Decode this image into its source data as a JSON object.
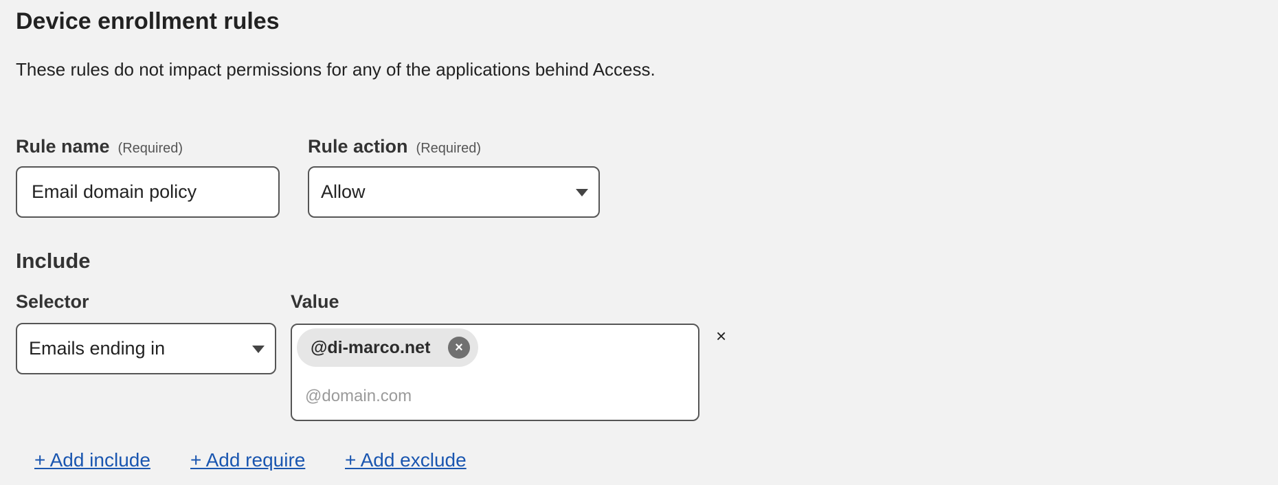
{
  "header": {
    "title": "Device enrollment rules",
    "description": "These rules do not impact permissions for any of the applications behind Access."
  },
  "rule_name": {
    "label": "Rule name",
    "required_hint": "(Required)",
    "value": "Email domain policy"
  },
  "rule_action": {
    "label": "Rule action",
    "required_hint": "(Required)",
    "selected": "Allow"
  },
  "include": {
    "heading": "Include",
    "selector_label": "Selector",
    "value_label": "Value",
    "selector_selected": "Emails ending in",
    "value_tags": [
      "@di-marco.net"
    ],
    "value_placeholder": "@domain.com",
    "tag_remove_glyph": "×",
    "row_remove_glyph": "×"
  },
  "actions": {
    "add_include": "+ Add include",
    "add_require": "+ Add require",
    "add_exclude": "+ Add exclude"
  },
  "colors": {
    "background": "#f2f2f2",
    "link": "#1a56b0",
    "tag_background": "#e6e6e6"
  }
}
